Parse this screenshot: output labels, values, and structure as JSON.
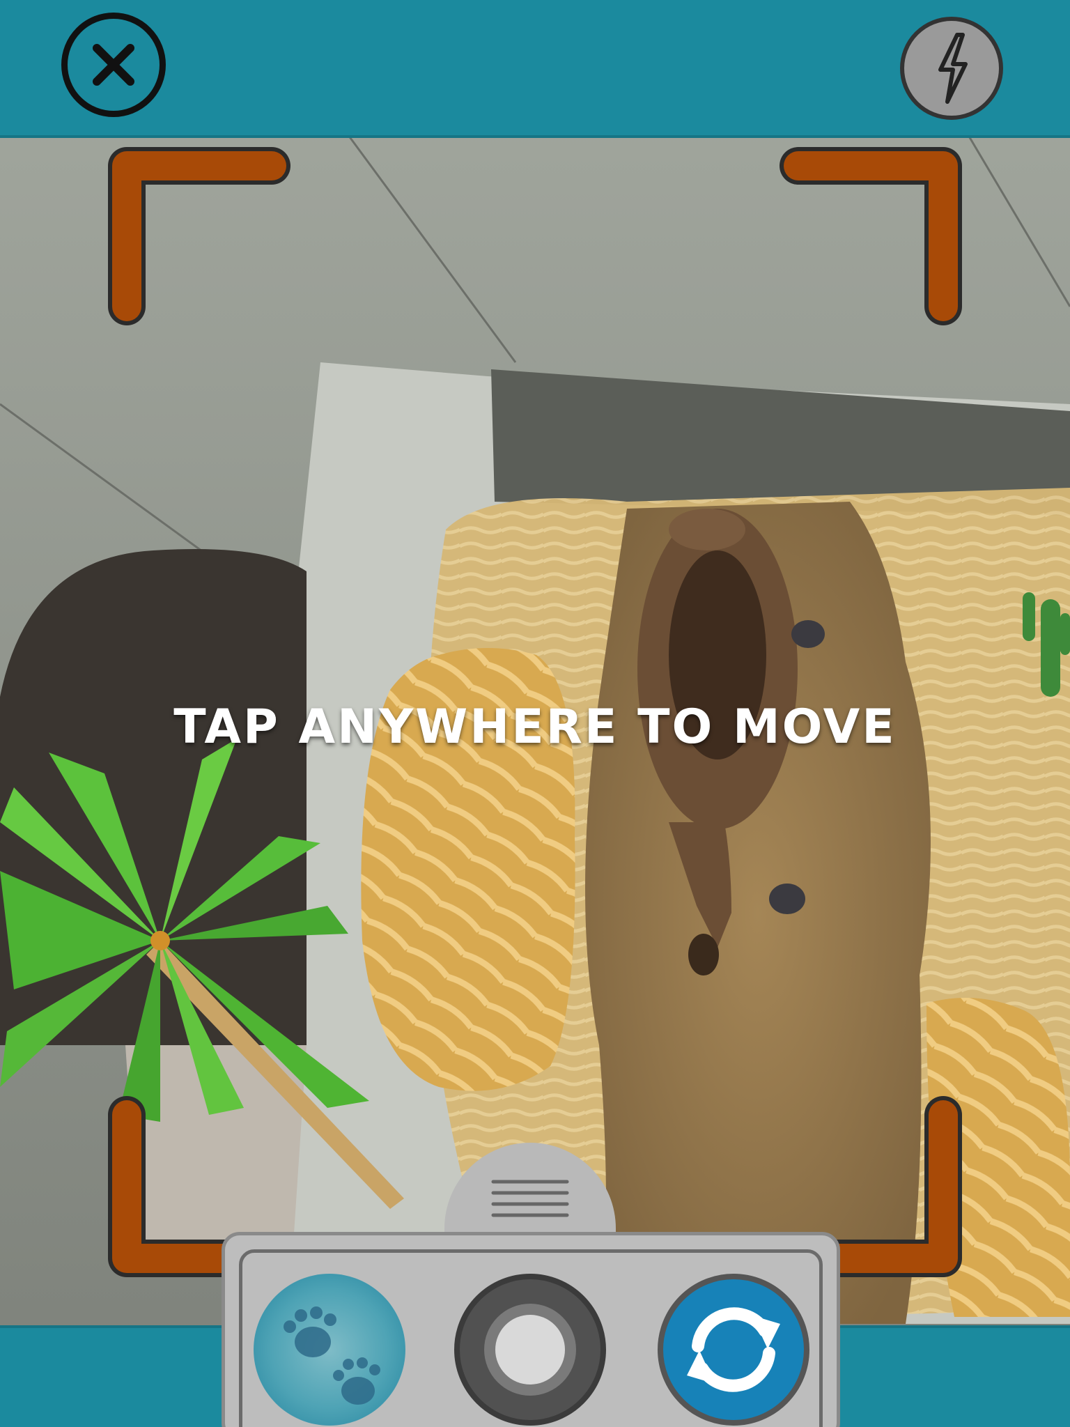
{
  "top_bar": {
    "close_icon": "close-circle-icon",
    "flash_icon": "flash-icon"
  },
  "scene": {
    "hint_text": "TAP ANYWHERE TO MOVE"
  },
  "tray": {
    "handle_icon": "menu-lines-icon",
    "buttons": [
      {
        "name": "animal-mode",
        "icon": "paw-prints-icon"
      },
      {
        "name": "shutter",
        "icon": "camera-shutter-icon"
      },
      {
        "name": "switch-camera",
        "icon": "refresh-arrows-icon"
      }
    ]
  },
  "colors": {
    "bar": "#1b8a9e",
    "frame_corners": "#a84a07",
    "switch_button": "#1782b8",
    "tray": "#bdbdbd"
  }
}
